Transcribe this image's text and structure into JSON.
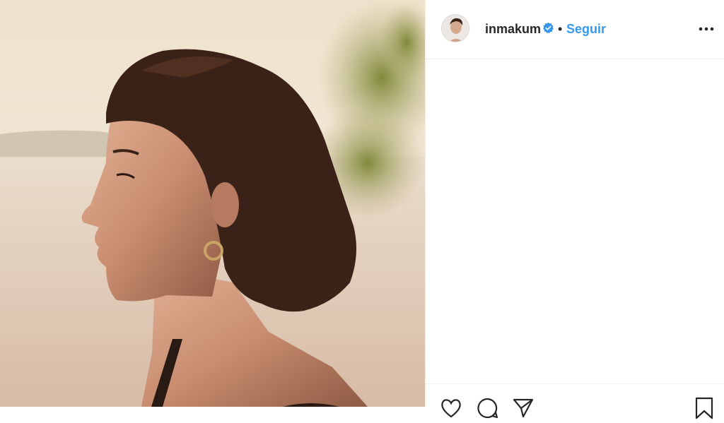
{
  "post": {
    "username": "inmakum",
    "separator": "•",
    "follow_label": "Seguir"
  },
  "icons": {
    "verified": "verified-badge-icon",
    "more": "more-options-icon",
    "like": "heart-icon",
    "comment": "comment-icon",
    "share": "share-icon",
    "save": "bookmark-icon"
  },
  "colors": {
    "accent": "#3897f0",
    "text": "#262626",
    "border": "#efefef"
  }
}
